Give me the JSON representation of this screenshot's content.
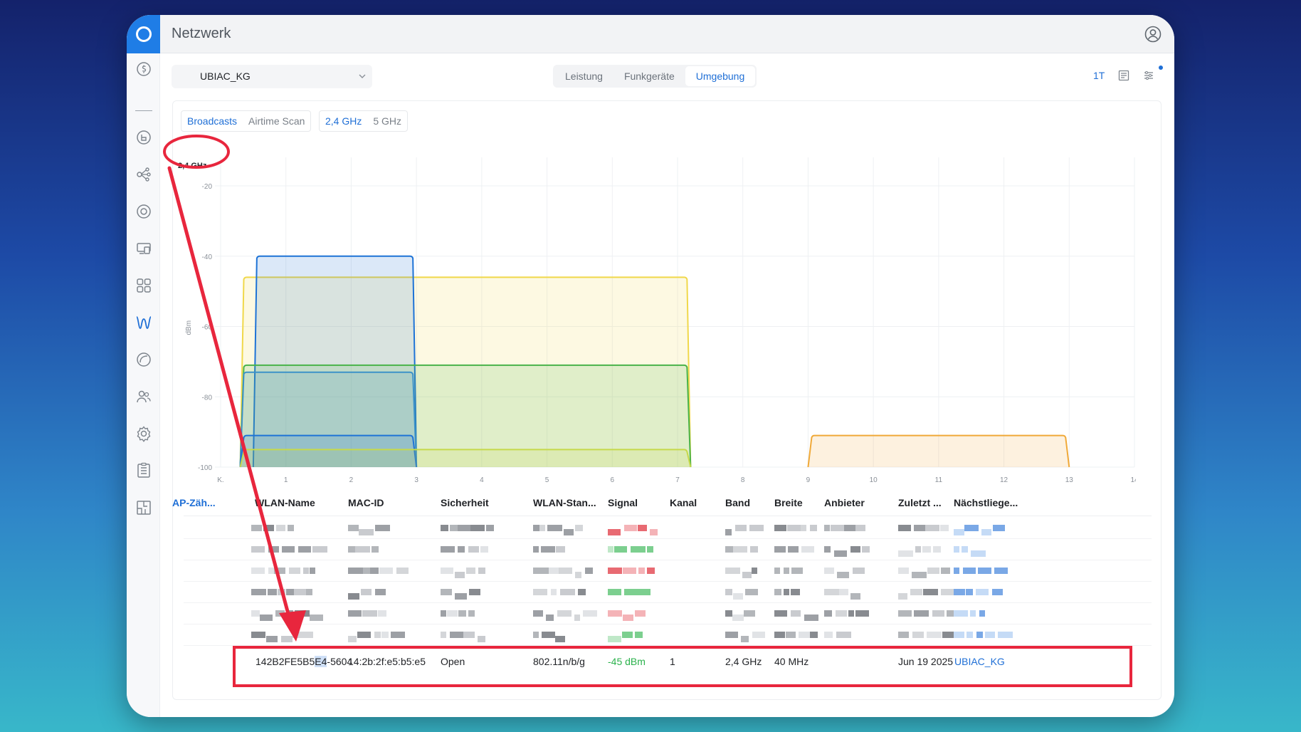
{
  "app": {
    "title": "Netzwerk"
  },
  "icons": {
    "logo": "ubiquiti-logo-icon",
    "user": "user-account-icon",
    "sidebar": [
      "dashboard-icon",
      "topology-icon",
      "client-devices-icon",
      "wifi-icon",
      "ubiquiti-devices-icon",
      "apps-grid-icon",
      "radio-manager-icon",
      "insights-icon",
      "clients-icon",
      "settings-icon",
      "logs-icon",
      "floorplan-icon"
    ]
  },
  "site_select": {
    "value": "UBIAC_KG"
  },
  "view_tabs": [
    "Leistung",
    "Funkgeräte",
    "Umgebung"
  ],
  "active_view_tab": "Umgebung",
  "time_range": "1T",
  "scan_tabs": [
    "Broadcasts",
    "Airtime Scan"
  ],
  "band_tabs": [
    "2,4 GHz",
    "5 GHz"
  ],
  "chart_data": {
    "type": "area",
    "title": "2,4 GHz",
    "ylabel": "dBm",
    "xlabel": "",
    "x_tick_labels": [
      "K.",
      "1",
      "2",
      "3",
      "4",
      "5",
      "6",
      "7",
      "8",
      "9",
      "10",
      "11",
      "12",
      "13",
      "14"
    ],
    "y_tick_labels": [
      "-20",
      "-40",
      "-60",
      "-80",
      "-100"
    ],
    "ylim": [
      -100,
      -20
    ],
    "xlim": [
      0,
      14
    ],
    "grid": true,
    "series": [
      {
        "color": "#f0d84a",
        "x_start": 0.3,
        "x_end": 7.2,
        "top": -46
      },
      {
        "color": "#1e73d6",
        "x_start": 0.5,
        "x_end": 3.0,
        "top": -40
      },
      {
        "color": "#49b34a",
        "x_start": 0.3,
        "x_end": 7.2,
        "top": -71
      },
      {
        "color": "#3d92c8",
        "x_start": 0.3,
        "x_end": 3.0,
        "top": -73
      },
      {
        "color": "#1e73d6",
        "x_start": 0.3,
        "x_end": 3.0,
        "top": -91
      },
      {
        "color": "#c6d94a",
        "x_start": 0.3,
        "x_end": 7.2,
        "top": -95
      },
      {
        "color": "#f0a938",
        "x_start": 9.0,
        "x_end": 13.0,
        "top": -91
      }
    ]
  },
  "table": {
    "headers": [
      "AP-Zäh...",
      "WLAN-Name",
      "MAC-ID",
      "Sicherheit",
      "WLAN-Stan...",
      "Signal",
      "Kanal",
      "Band",
      "Breite",
      "Anbieter",
      "Zuletzt ...",
      "Nächstliege..."
    ],
    "highlighted_row": {
      "wlan_name_part1": "142B2FE5B5",
      "wlan_name_selected": "E4",
      "wlan_name_part2": "-5604",
      "mac_id": "14:2b:2f:e5:b5:e5",
      "security": "Open",
      "standard": "802.11n/b/g",
      "signal": "-45 dBm",
      "channel": "1",
      "band": "2,4 GHz",
      "width": "40 MHz",
      "last_seen": "Jun 19 2025",
      "nearest": "UBIAC_KG"
    }
  },
  "colors": {
    "accent": "#1f6fd6",
    "annotation": "#e8263d",
    "signal_good": "#2bb24c"
  }
}
